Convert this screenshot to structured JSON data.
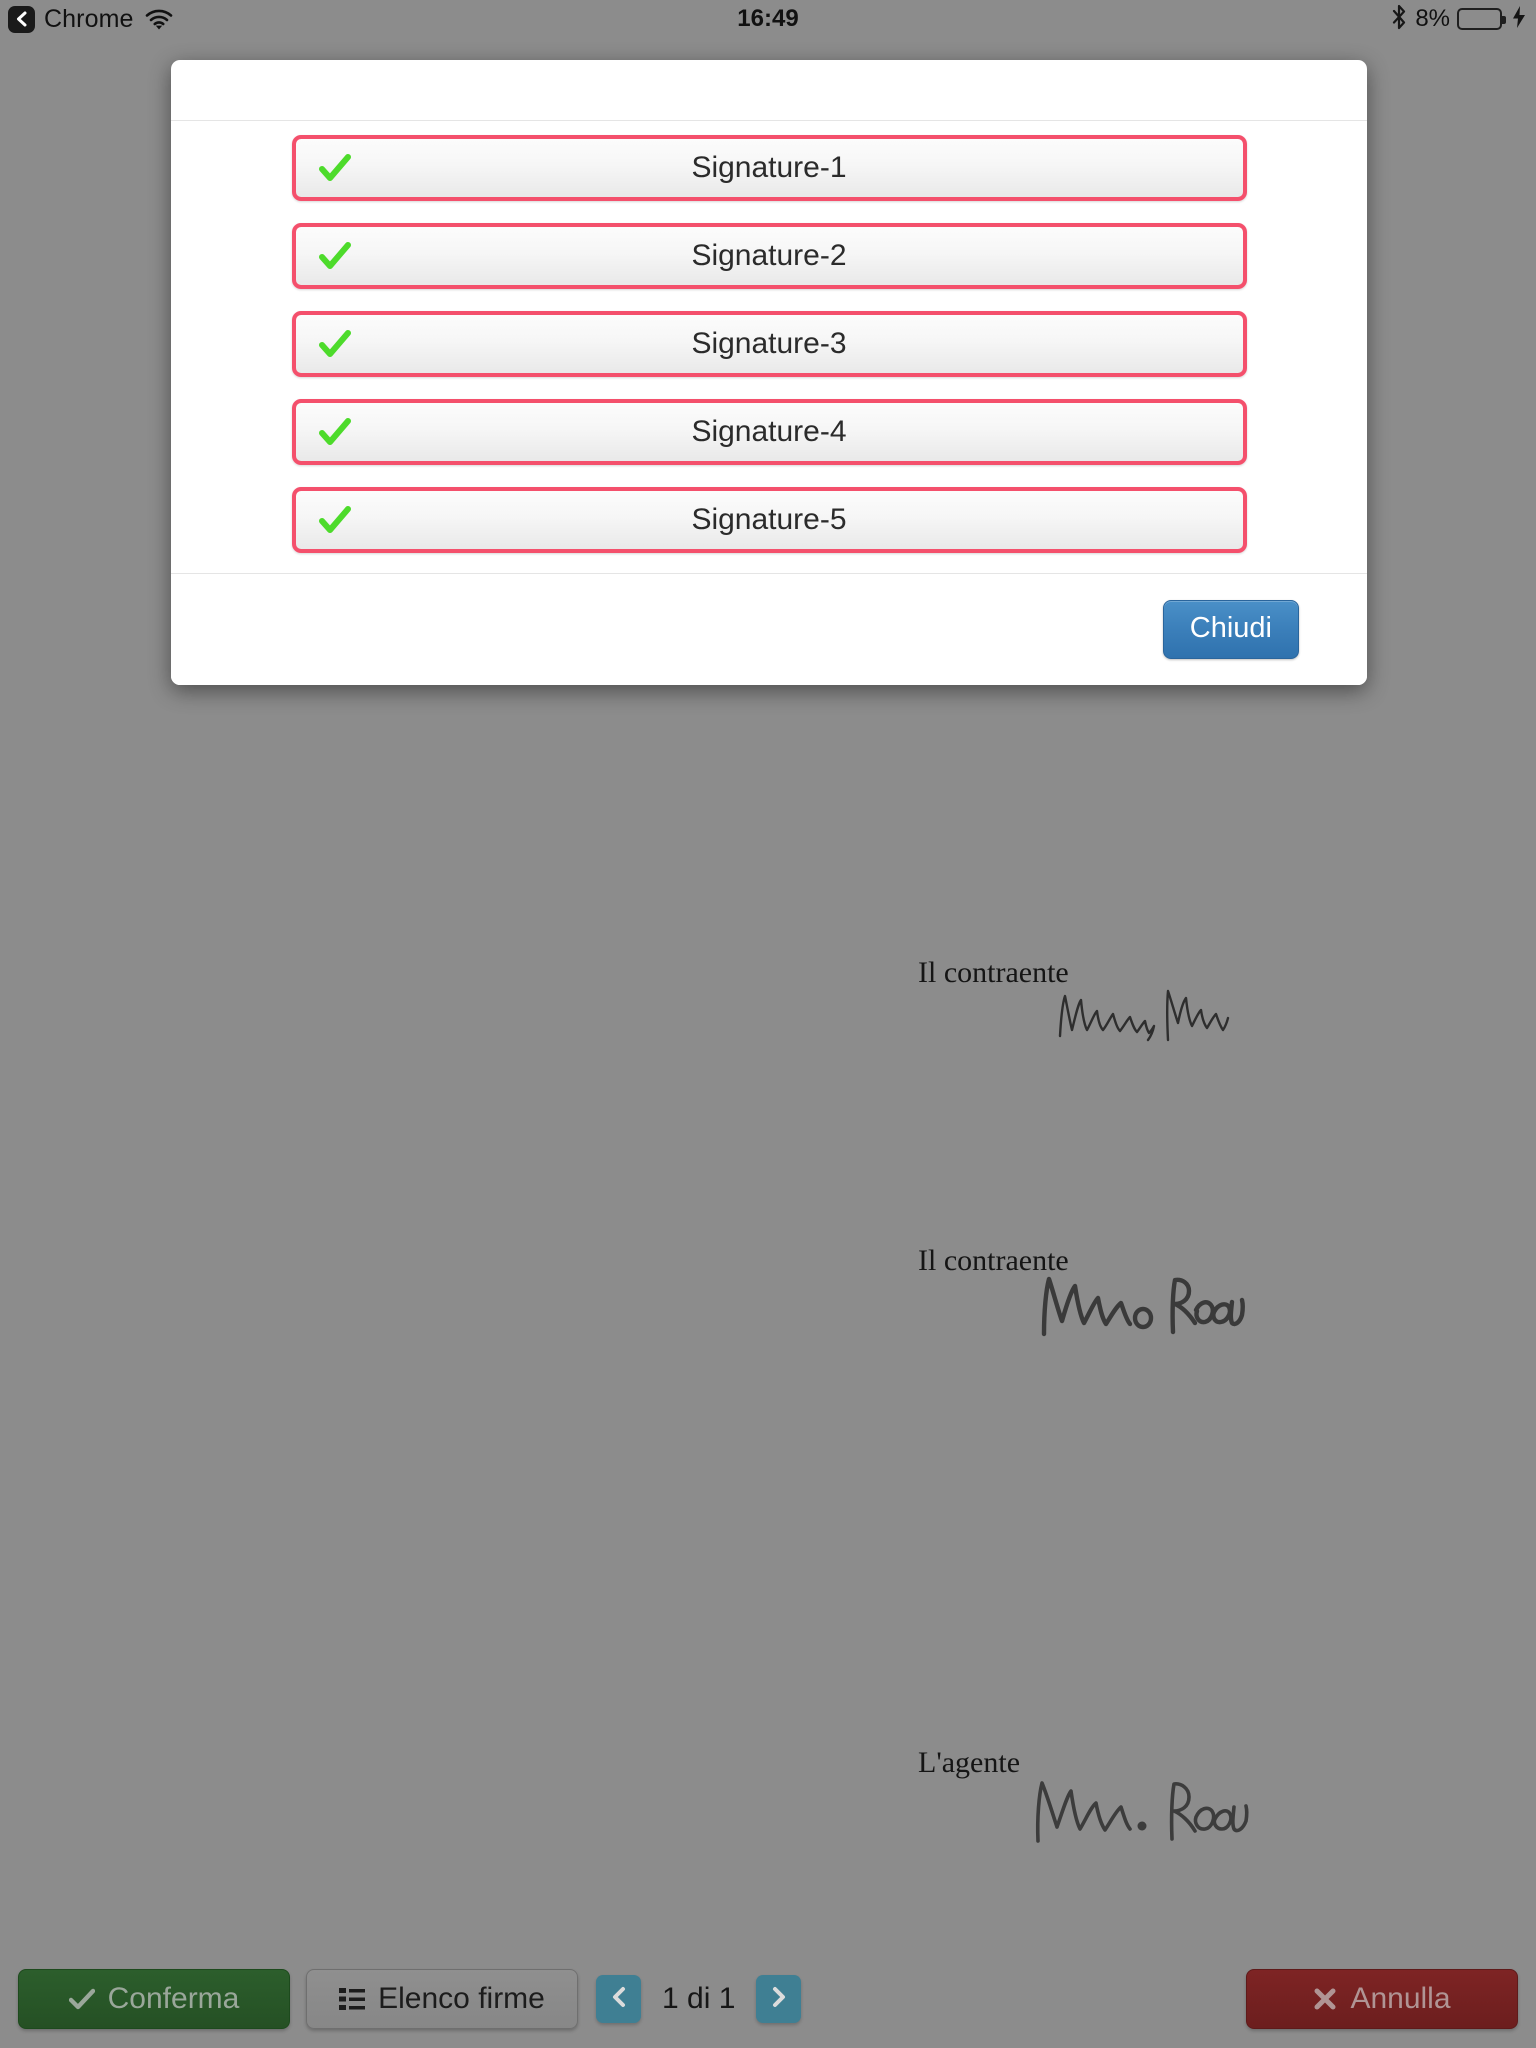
{
  "status_bar": {
    "back_label": "Chrome",
    "back_icon": "chevron-left-icon",
    "wifi_icon": "wifi-icon",
    "time": "16:49",
    "bluetooth_icon": "bluetooth-icon",
    "battery_percent": "8%",
    "battery_level": 8,
    "battery_color": "#f02d22",
    "charging_icon": "lightning-bolt-icon"
  },
  "modal": {
    "title": "",
    "signatures": [
      {
        "label": "Signature-1",
        "checked": true
      },
      {
        "label": "Signature-2",
        "checked": true
      },
      {
        "label": "Signature-3",
        "checked": true
      },
      {
        "label": "Signature-4",
        "checked": true
      },
      {
        "label": "Signature-5",
        "checked": true
      }
    ],
    "check_icon": "check-mark-icon",
    "border_color": "#f4506c",
    "check_color": "#4ddb2b",
    "close_button": {
      "label": "Chiudi",
      "color": "#3b7fba"
    }
  },
  "document": {
    "signature_blocks": [
      {
        "caption": "Il contraente",
        "signature_text": "Mario Rossi",
        "style": "thin"
      },
      {
        "caption": "Il contraente",
        "signature_text": "Mario Rossi",
        "style": "bold"
      },
      {
        "caption": "L'agente",
        "signature_text": "Mario Rossi",
        "style": "medium"
      }
    ]
  },
  "toolbar": {
    "confirm": {
      "label": "Conferma",
      "icon": "check-mark-icon",
      "color": "#2c5e2c"
    },
    "signature_list": {
      "label": "Elenco firme",
      "icon": "list-icon",
      "color": "#8f8f8f"
    },
    "pagination": {
      "prev_icon": "chevron-left-icon",
      "next_icon": "chevron-right-icon",
      "counter": "1 di 1",
      "current_page": 1,
      "total_pages": 1,
      "color": "#3f7f93"
    },
    "cancel": {
      "label": "Annulla",
      "icon": "close-x-icon",
      "color": "#7e2424"
    }
  }
}
